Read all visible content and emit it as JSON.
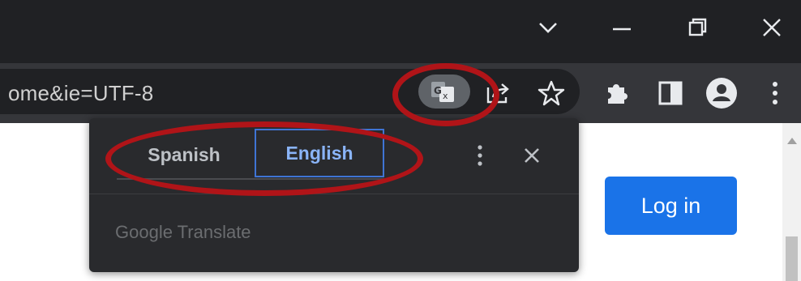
{
  "window": {
    "controls": [
      {
        "name": "tab-search-icon",
        "symbol": "chevron-down"
      },
      {
        "name": "minimize-icon",
        "symbol": "minimize"
      },
      {
        "name": "restore-icon",
        "symbol": "restore"
      },
      {
        "name": "close-icon",
        "symbol": "close"
      }
    ]
  },
  "toolbar": {
    "url": "ome&ie=UTF-8",
    "icons": [
      "translate-icon",
      "share-icon",
      "bookmark-star-icon",
      "extensions-icon",
      "side-panel-icon",
      "profile-icon",
      "menu-icon"
    ]
  },
  "translate_popup": {
    "tabs": [
      {
        "label": "Spanish",
        "selected": false
      },
      {
        "label": "English",
        "selected": true
      }
    ],
    "footer": "Google Translate",
    "icons": [
      "more-options-icon",
      "close-icon"
    ]
  },
  "page": {
    "login_label": "Log in"
  },
  "colors": {
    "accent": "#1a73e8",
    "highlight": "#b01418",
    "selected_tab_text": "#8ab4f8",
    "selected_tab_border": "#3f74d4"
  }
}
